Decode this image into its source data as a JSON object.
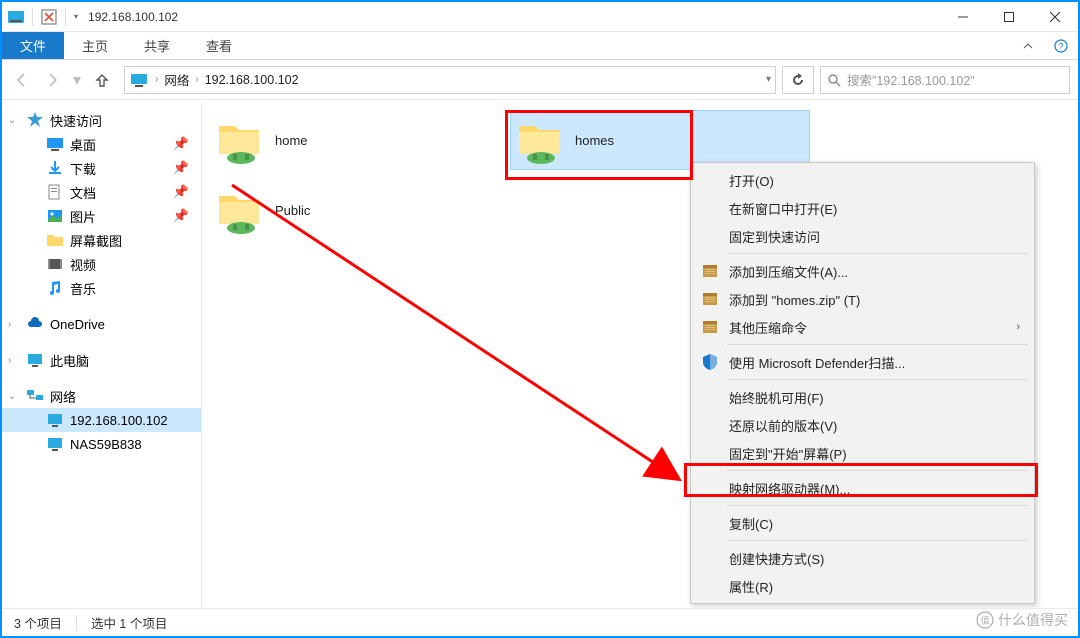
{
  "window_title": "192.168.100.102",
  "ribbon": {
    "file": "文件",
    "home": "主页",
    "share": "共享",
    "view": "查看"
  },
  "breadcrumb": {
    "root": "网络",
    "host": "192.168.100.102"
  },
  "search_placeholder": "搜索\"192.168.100.102\"",
  "sidebar": {
    "quick_access": "快速访问",
    "desktop": "桌面",
    "downloads": "下载",
    "documents": "文档",
    "pictures": "图片",
    "screenshots": "屏幕截图",
    "videos": "视频",
    "music": "音乐",
    "onedrive": "OneDrive",
    "this_pc": "此电脑",
    "network": "网络",
    "net_host1": "192.168.100.102",
    "net_host2": "NAS59B838"
  },
  "items": {
    "home": "home",
    "homes": "homes",
    "public": "Public"
  },
  "context_menu": {
    "open": "打开(O)",
    "open_new": "在新窗口中打开(E)",
    "pin_qa": "固定到快速访问",
    "add_archive": "添加到压缩文件(A)...",
    "add_zip": "添加到 \"homes.zip\" (T)",
    "other_zip": "其他压缩命令",
    "defender": "使用 Microsoft Defender扫描...",
    "offline": "始终脱机可用(F)",
    "restore": "还原以前的版本(V)",
    "pin_start": "固定到\"开始\"屏幕(P)",
    "map_drive": "映射网络驱动器(M)...",
    "copy": "复制(C)",
    "shortcut": "创建快捷方式(S)",
    "properties": "属性(R)"
  },
  "status": {
    "count": "3 个项目",
    "selected": "选中 1 个项目"
  },
  "watermark": "什么值得买"
}
